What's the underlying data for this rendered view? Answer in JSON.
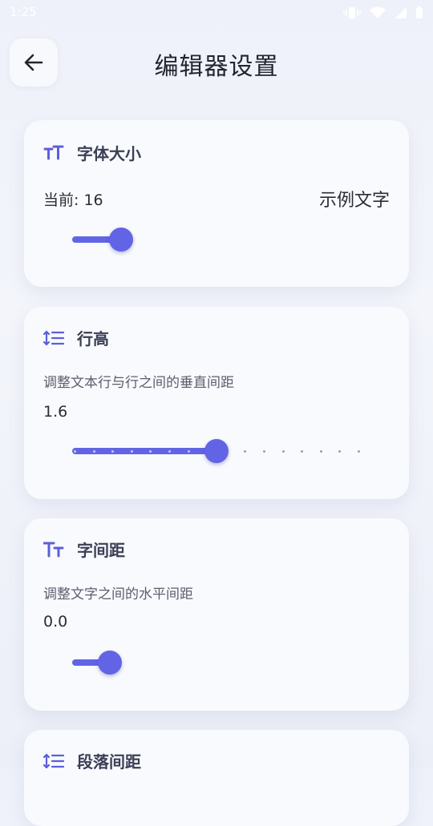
{
  "status": {
    "time": "1:25"
  },
  "header": {
    "title": "编辑器设置"
  },
  "icons": {
    "back": "arrow-left-icon",
    "font_size": "font-size-icon",
    "line_height": "line-height-icon",
    "letter_spacing": "letter-spacing-icon",
    "paragraph_spacing": "paragraph-spacing-icon"
  },
  "colors": {
    "accent": "#6264e6",
    "icon": "#5c5fd9",
    "card": "#f9fafd"
  },
  "cards": {
    "font_size": {
      "title": "字体大小",
      "current": "当前: 16",
      "sample": "示例文字",
      "slider_fraction": 0.04
    },
    "line_height": {
      "title": "行高",
      "description": "调整文本行与行之间的垂直间距",
      "value": "1.6",
      "slider_fraction": 0.39,
      "steps": 16
    },
    "letter_spacing": {
      "title": "字间距",
      "description": "调整文字之间的水平间距",
      "value": "0.0",
      "slider_fraction": 0.0
    },
    "paragraph_spacing": {
      "title": "段落间距"
    }
  }
}
